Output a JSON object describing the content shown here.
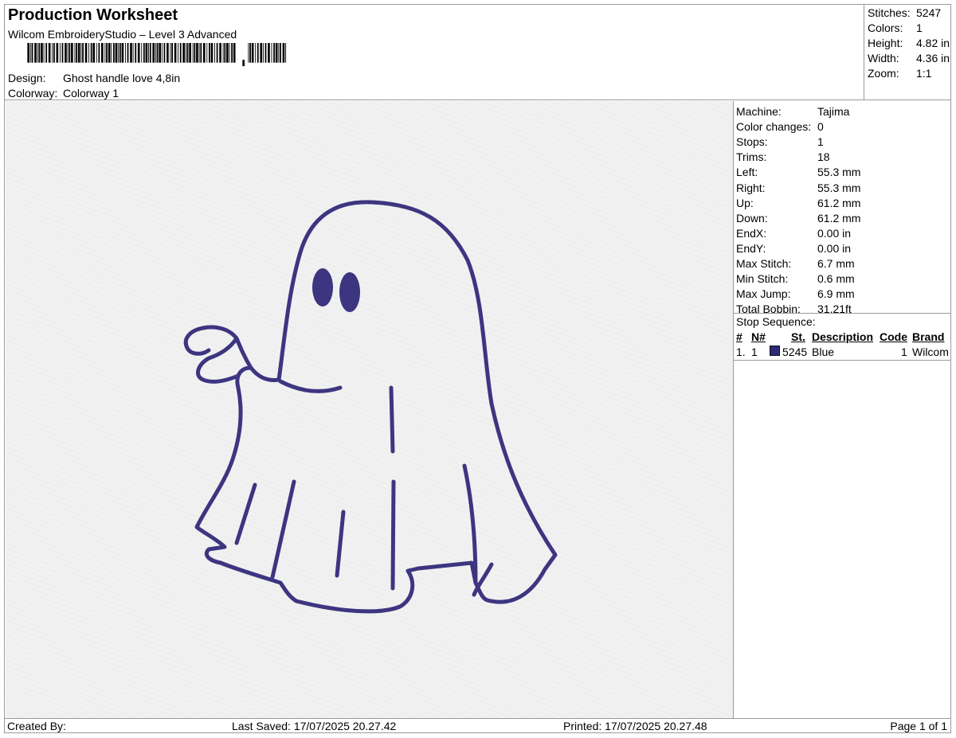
{
  "header": {
    "title": "Production Worksheet",
    "software": "Wilcom EmbroideryStudio – Level 3 Advanced",
    "design_label": "Design:",
    "design_value": "Ghost handle love 4,8in",
    "colorway_label": "Colorway:",
    "colorway_value": "Colorway 1"
  },
  "summary": [
    {
      "label": "Stitches:",
      "value": "5247"
    },
    {
      "label": "Colors:",
      "value": "1"
    },
    {
      "label": "Height:",
      "value": "4.82 in"
    },
    {
      "label": "Width:",
      "value": "4.36 in"
    },
    {
      "label": "Zoom:",
      "value": "1:1"
    }
  ],
  "machine_info": [
    {
      "label": "Machine:",
      "value": "Tajima"
    },
    {
      "label": "Color changes:",
      "value": "0"
    },
    {
      "label": "Stops:",
      "value": "1"
    },
    {
      "label": "Trims:",
      "value": "18"
    },
    {
      "label": "Left:",
      "value": "55.3 mm"
    },
    {
      "label": "Right:",
      "value": "55.3 mm"
    },
    {
      "label": "Up:",
      "value": "61.2 mm"
    },
    {
      "label": "Down:",
      "value": "61.2 mm"
    },
    {
      "label": "EndX:",
      "value": "0.00 in"
    },
    {
      "label": "EndY:",
      "value": "0.00 in"
    },
    {
      "label": "Max Stitch:",
      "value": "6.7 mm"
    },
    {
      "label": "Min Stitch:",
      "value": "0.6 mm"
    },
    {
      "label": "Max Jump:",
      "value": "6.9 mm"
    },
    {
      "label": "Total Bobbin:",
      "value": "31.21ft"
    }
  ],
  "stop_sequence": {
    "label": "Stop Sequence:",
    "columns": [
      "#",
      "N#",
      "St.",
      "Description",
      "Code",
      "Brand"
    ],
    "rows": [
      {
        "index": "1.",
        "n": "1",
        "stitches": "5245",
        "description": "Blue",
        "code": "1",
        "brand": "Wilcom",
        "color": "#2e2a78"
      }
    ]
  },
  "footer": {
    "created_by": "Created By:",
    "last_saved": "Last Saved: 17/07/2025 20.27.42",
    "printed": "Printed: 17/07/2025 20.27.48",
    "page": "Page 1 of 1"
  },
  "colors": {
    "thread": "#3d3580",
    "fabric": "#f1f1f1",
    "border": "#9a9a9a"
  }
}
